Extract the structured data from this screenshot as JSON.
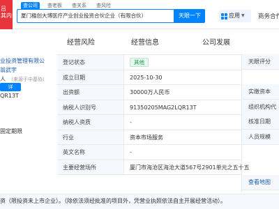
{
  "header": {
    "logo_text": "吕\n其内",
    "tabs": [
      "查公司",
      "查老板",
      "查关系",
      "查风险"
    ],
    "search_value": "厦门楹创大博医疗产业创业投资合伙企业（有限合伙）",
    "search_button": "天眼一下",
    "app_button": "应用",
    "business_coop": "商务合作"
  },
  "nav": {
    "items": [
      "经营风险",
      "经营信息",
      "公司发展"
    ]
  },
  "left_col": {
    "line1": "业投资管理有限公",
    "line2": "翁武宇",
    "line3": "人",
    "line3_note": "（来源于中基协）",
    "tag": "详",
    "code": "QR13T",
    "term": "固定期限"
  },
  "table": {
    "rows": [
      {
        "label": "登记状态",
        "value": "其他",
        "badge": true
      },
      {
        "label": "成立日期",
        "value": "2025-10-30"
      },
      {
        "label": "出资额",
        "value": "30000万人民币"
      },
      {
        "label": "纳税人识别号",
        "value": "91350205MAG2LQR13T"
      },
      {
        "label": "纳税人资质",
        "value": "-"
      },
      {
        "label": "行业",
        "value": "资本市场服务"
      },
      {
        "label": "英文名称",
        "value": "-"
      },
      {
        "label": "主要经营场所",
        "value": "厦门市海沧区海沧大道567号2901单元之五十五"
      }
    ]
  },
  "right_col": {
    "items": [
      "天眼评分",
      "实缴资本",
      "组织机构代",
      "核准日期",
      "人员规模",
      "",
      "",
      "查看地图"
    ]
  },
  "bottom_text": "资（限投资未上市企业）。（除依法须经批准的项目外，凭营业执照依法自主开展经营活动）。",
  "colors": {
    "accent": "#0084ff",
    "logo_red": "#e8353b",
    "status_green": "#0e9b4d"
  }
}
